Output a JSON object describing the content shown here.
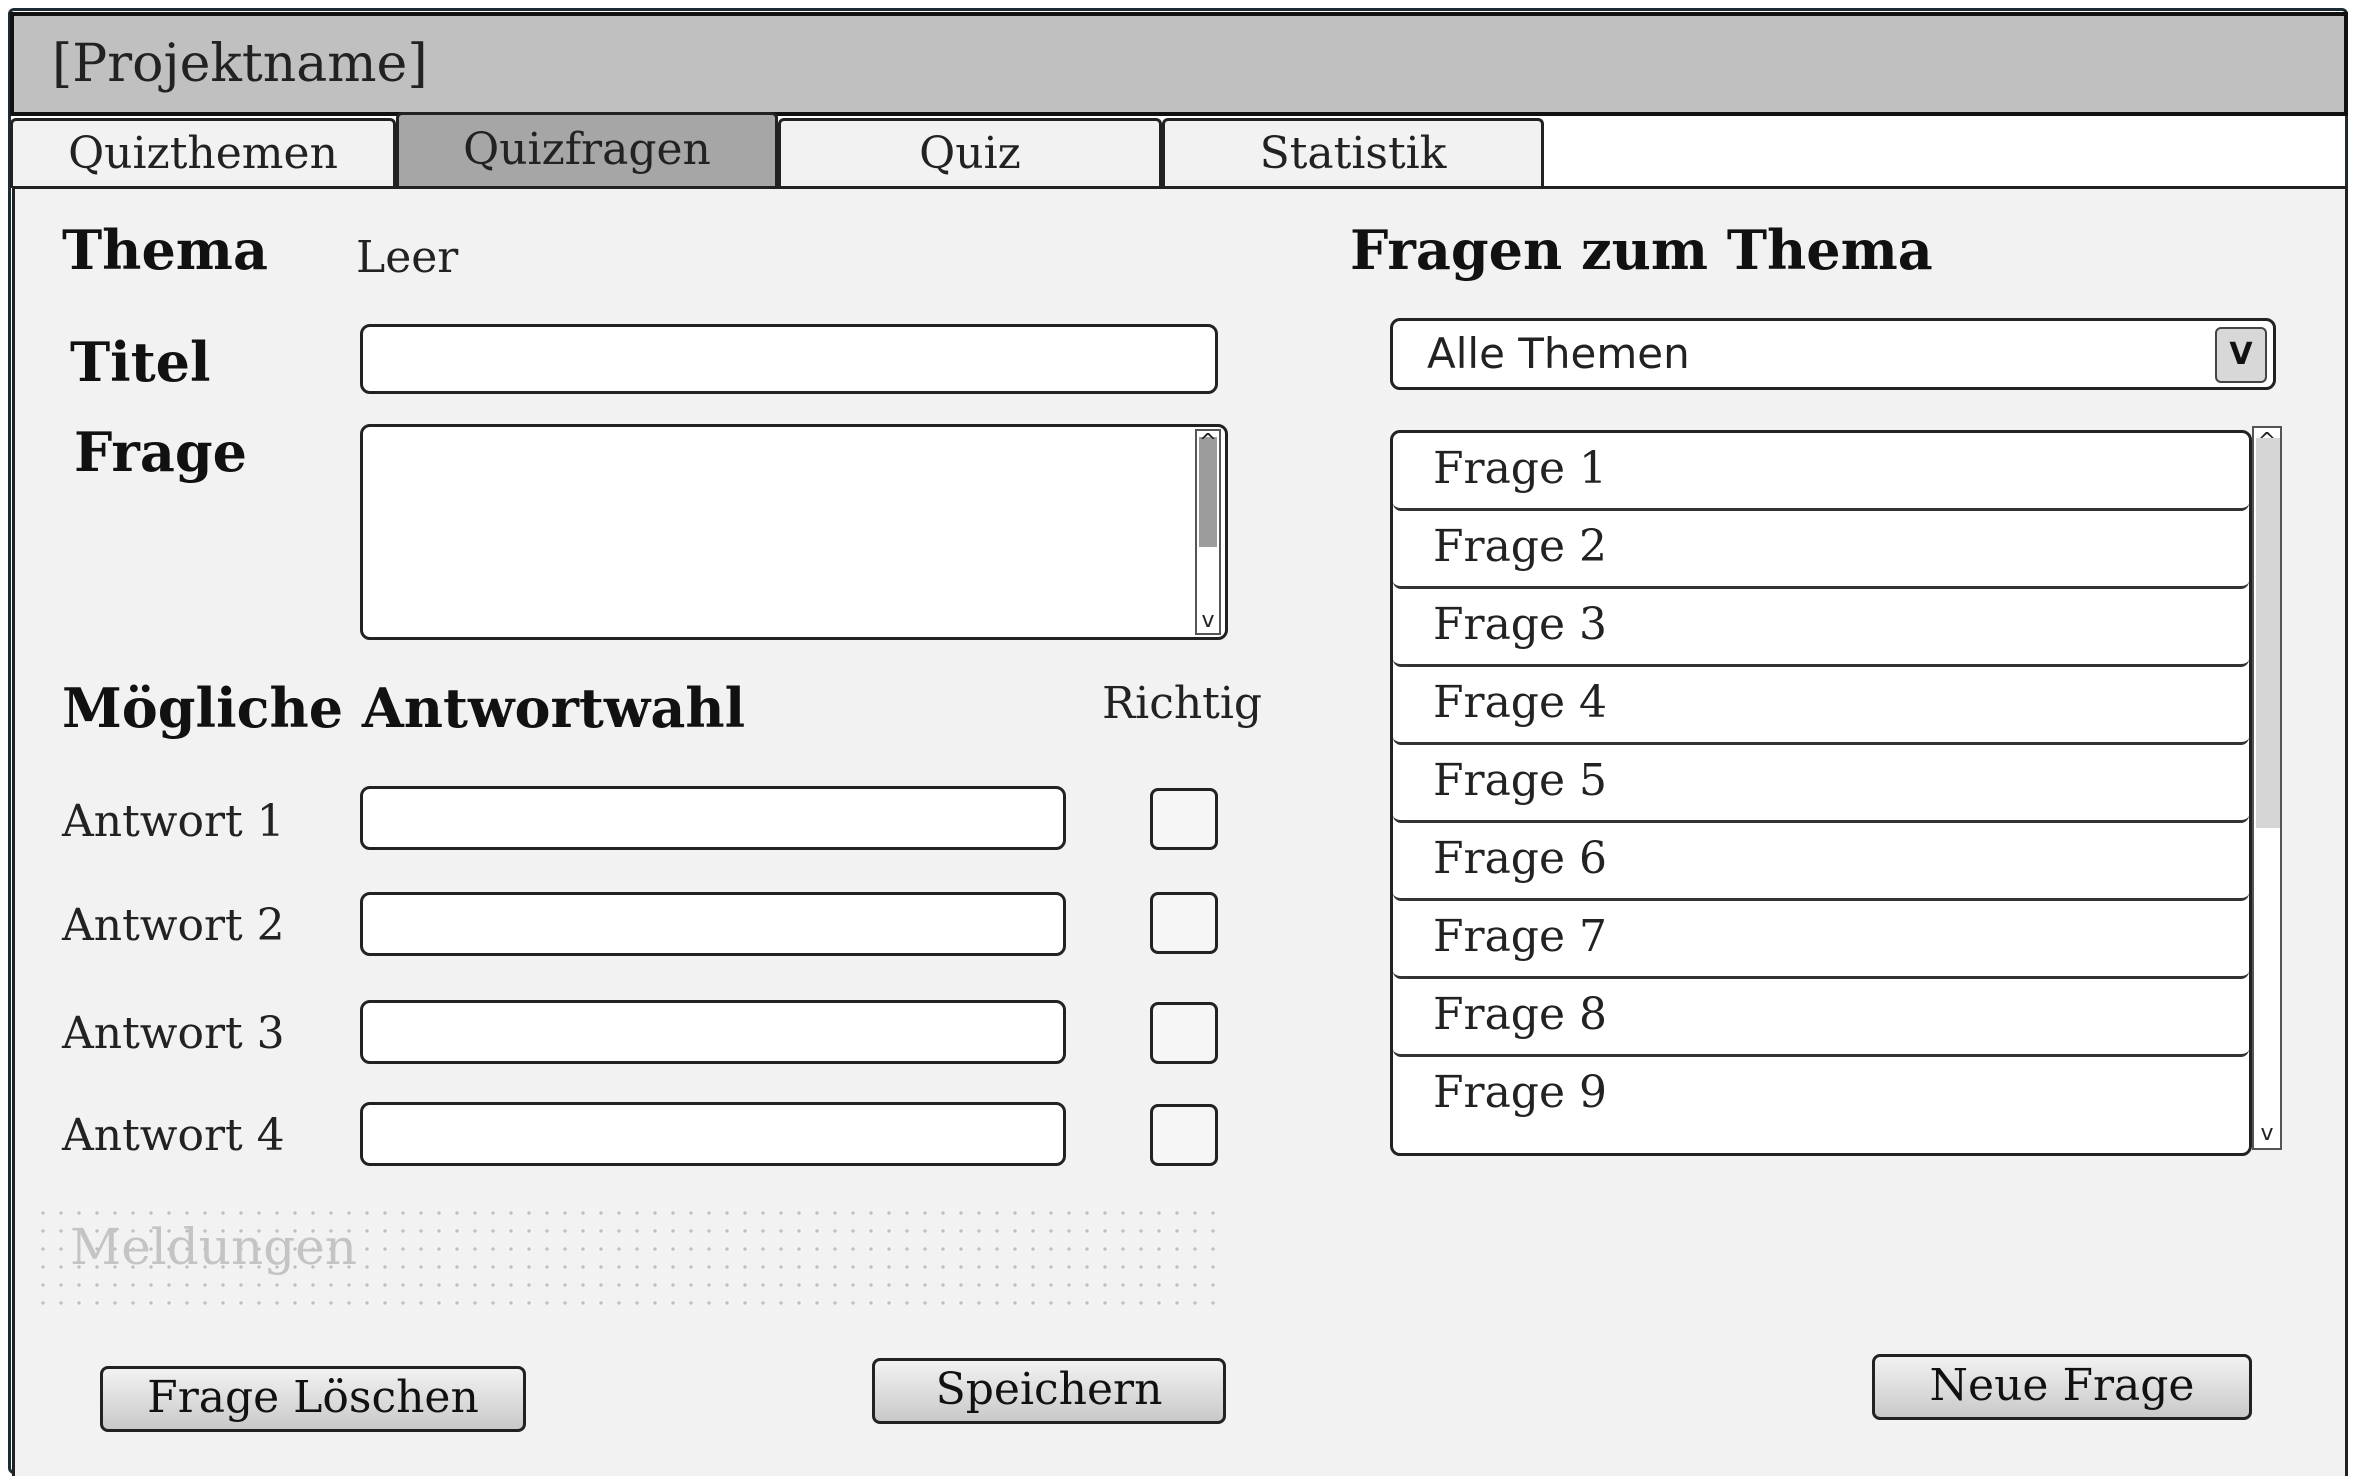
{
  "window": {
    "title": "[Projektname]"
  },
  "tabs": [
    {
      "label": "Quizthemen",
      "active": false
    },
    {
      "label": "Quizfragen",
      "active": true
    },
    {
      "label": "Quiz",
      "active": false
    },
    {
      "label": "Statistik",
      "active": false
    }
  ],
  "form": {
    "thema_label": "Thema",
    "thema_value": "Leer",
    "titel_label": "Titel",
    "titel_value": "",
    "frage_label": "Frage",
    "frage_value": "",
    "answers_heading": "Mögliche Antwortwahl",
    "correct_heading": "Richtig",
    "answers": [
      {
        "label": "Antwort 1",
        "value": "",
        "correct": false
      },
      {
        "label": "Antwort 2",
        "value": "",
        "correct": false
      },
      {
        "label": "Antwort 3",
        "value": "",
        "correct": false
      },
      {
        "label": "Antwort 4",
        "value": "",
        "correct": false
      }
    ],
    "messages_placeholder": "Meldungen"
  },
  "questions_panel": {
    "heading": "Fragen zum Thema",
    "filter_selected": "Alle Themen",
    "filter_arrow": "V",
    "items": [
      "Frage 1",
      "Frage 2",
      "Frage 3",
      "Frage 4",
      "Frage 5",
      "Frage 6",
      "Frage 7",
      "Frage 8",
      "Frage 9"
    ]
  },
  "buttons": {
    "delete_label": "Frage Löschen",
    "save_label": "Speichern",
    "new_label": "Neue Frage"
  },
  "icons": {
    "scroll_up": "^",
    "scroll_down": "v"
  },
  "colors": {
    "titlebar": "#c0c0c0",
    "active_tab": "#a6a6a6",
    "panel": "#f2f2f2",
    "border": "#222222"
  }
}
